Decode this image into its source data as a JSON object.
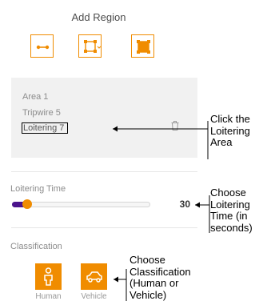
{
  "panel": {
    "title": "Add Region",
    "tools": [
      {
        "icon": "tripwire-icon"
      },
      {
        "icon": "polygon-area-icon"
      },
      {
        "icon": "full-frame-icon"
      }
    ],
    "areas": [
      {
        "label": "Area 1"
      },
      {
        "label": "Tripwire 5"
      },
      {
        "label": "Loitering 7",
        "selected": true
      }
    ],
    "loitering": {
      "label": "Loitering Time",
      "value": "30",
      "slider_fraction": 0.08
    },
    "classification": {
      "label": "Classification",
      "options": [
        {
          "label": "Human",
          "icon": "human-icon"
        },
        {
          "label": "Vehicle",
          "icon": "vehicle-icon"
        }
      ]
    },
    "accent_color": "#f08c00",
    "slider_fill_color": "#4b148c"
  },
  "annotations": {
    "area": [
      "Click the",
      "Loitering",
      "Area"
    ],
    "time": [
      "Choose",
      "Loitering",
      "Time (in",
      "seconds)"
    ],
    "classification": [
      "Choose",
      "Classification",
      "(Human or",
      "Vehicle)"
    ]
  }
}
